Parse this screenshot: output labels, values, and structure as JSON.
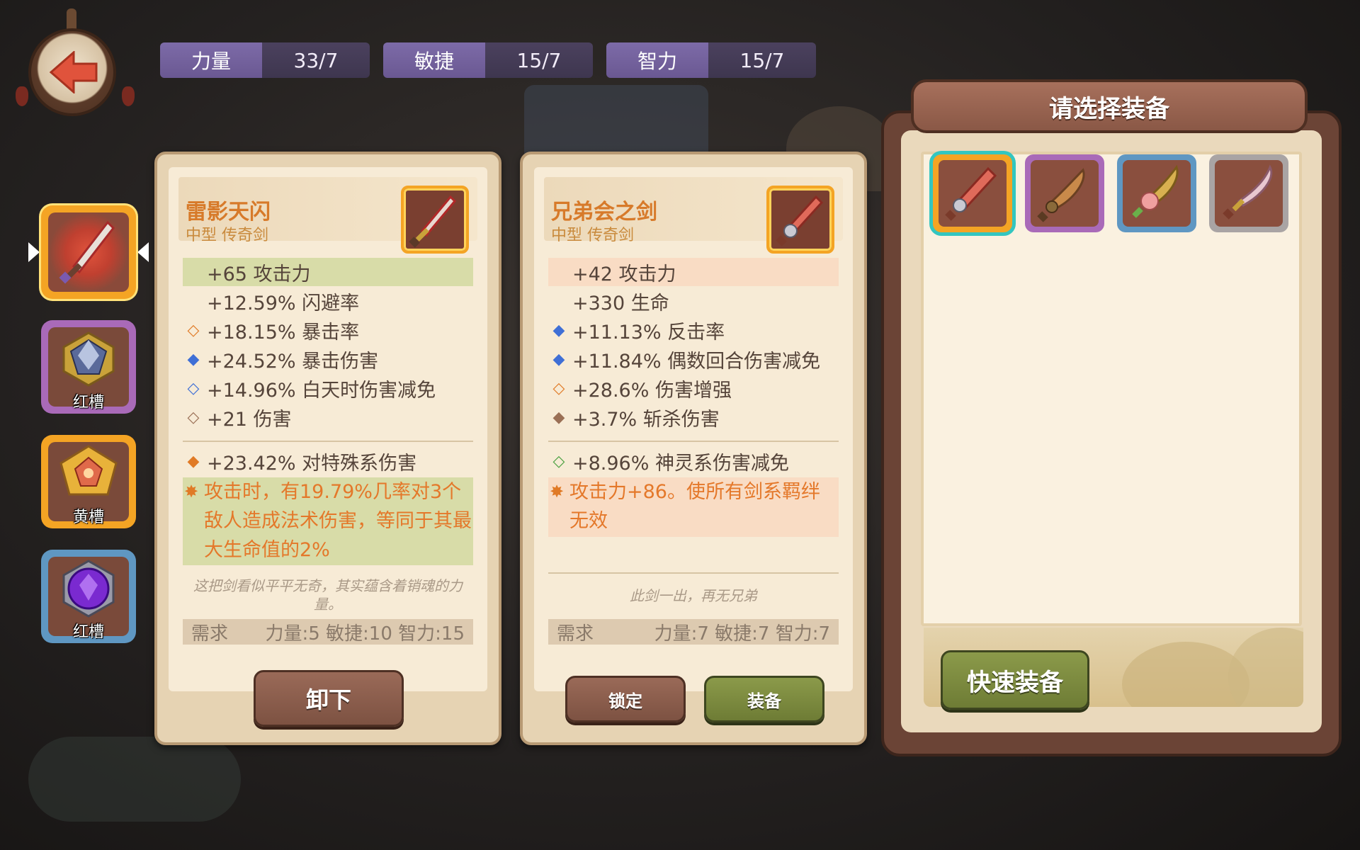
{
  "stats": [
    {
      "label": "力量",
      "value": "33/7"
    },
    {
      "label": "敏捷",
      "value": "15/7"
    },
    {
      "label": "智力",
      "value": "15/7"
    }
  ],
  "slots": [
    {
      "label": ""
    },
    {
      "label": "红槽"
    },
    {
      "label": "黄槽"
    },
    {
      "label": "红槽"
    }
  ],
  "equipped": {
    "name": "雷影天闪",
    "type": "中型 传奇剑",
    "attributes": [
      {
        "icon": "",
        "text": "+65 攻击力"
      },
      {
        "icon": "",
        "text": "+12.59% 闪避率"
      },
      {
        "icon": "◇",
        "text": "+18.15% 暴击率"
      },
      {
        "icon": "◆",
        "text": "+24.52% 暴击伤害"
      },
      {
        "icon": "◇",
        "text": "+14.96% 白天时伤害减免"
      },
      {
        "icon": "◇",
        "text": "+21 伤害"
      }
    ],
    "bonus": {
      "icon": "◆",
      "text": "+23.42% 对特殊系伤害"
    },
    "special": "攻击时，有19.79%几率对3个敌人造成法术伤害，等同于其最大生命值的2%",
    "flavor": "这把剑看似平平无奇，其实蕴含着销魂的力量。",
    "req_label": "需求",
    "req_value": "力量:5 敏捷:10 智力:15",
    "unequip_label": "卸下"
  },
  "candidate": {
    "name": "兄弟会之剑",
    "type": "中型 传奇剑",
    "attributes": [
      {
        "icon": "",
        "text": "+42 攻击力"
      },
      {
        "icon": "",
        "text": "+330 生命"
      },
      {
        "icon": "◆",
        "text": "+11.13% 反击率"
      },
      {
        "icon": "◆",
        "text": "+11.84% 偶数回合伤害减免"
      },
      {
        "icon": "◇",
        "text": "+28.6% 伤害增强"
      },
      {
        "icon": "◆",
        "text": "+3.7% 斩杀伤害"
      }
    ],
    "bonus": {
      "icon": "◇",
      "text": "+8.96% 神灵系伤害减免"
    },
    "special": "攻击力+86。使所有剑系羁绊无效",
    "flavor": "此剑一出，再无兄弟",
    "req_label": "需求",
    "req_value": "力量:7 敏捷:7 智力:7",
    "lock_label": "锁定",
    "equip_label": "装备"
  },
  "select_panel": {
    "title": "请选择装备",
    "quick_equip_label": "快速装备"
  },
  "colors": {
    "legendary_orange": "#f4a424",
    "epic_purple": "#a96ab8",
    "rare_blue": "#5f97c2",
    "common_gray": "#a9a4a4",
    "selected_teal": "#33c6c0",
    "blue_diamond": "#3f6fd6",
    "orange_diamond": "#e07a26",
    "brown_diamond": "#9a6f55",
    "green_diamond": "#4aa040"
  }
}
